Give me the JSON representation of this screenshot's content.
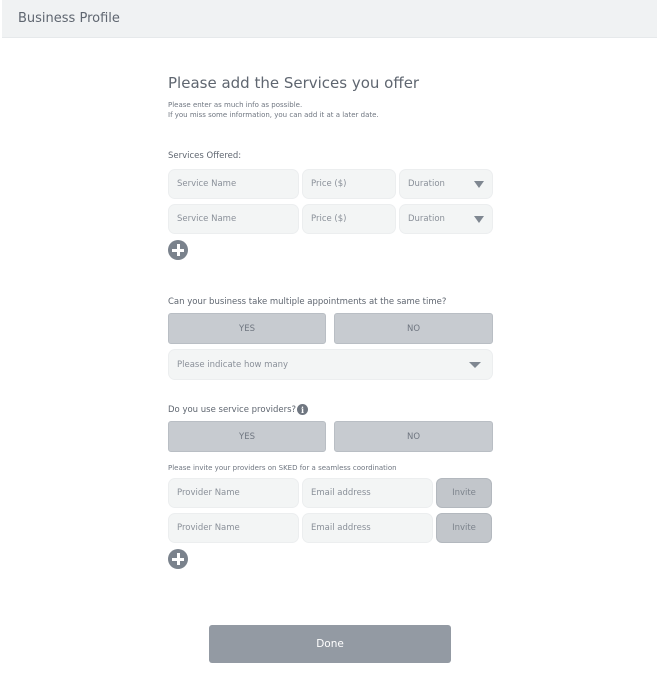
{
  "header": {
    "title": "Business Profile"
  },
  "intro": {
    "heading": "Please add the Services you offer",
    "line1": "Please enter as much info as possible.",
    "line2": "If you miss some information, you can add it at a later date."
  },
  "services": {
    "label": "Services Offered:",
    "rows": [
      {
        "name_placeholder": "Service Name",
        "price_placeholder": "Price ($)",
        "duration_placeholder": "Duration"
      },
      {
        "name_placeholder": "Service Name",
        "price_placeholder": "Price ($)",
        "duration_placeholder": "Duration"
      }
    ]
  },
  "multiple": {
    "question": "Can your business take multiple appointments at the same time?",
    "yes_label": "YES",
    "no_label": "NO",
    "select_placeholder": "Please indicate how many"
  },
  "providers": {
    "question": "Do you use service providers?",
    "yes_label": "YES",
    "no_label": "NO",
    "note": "Please invite your providers on SKED for a seamless coordination",
    "rows": [
      {
        "name_placeholder": "Provider Name",
        "email_placeholder": "Email address",
        "invite_label": "Invite"
      },
      {
        "name_placeholder": "Provider Name",
        "email_placeholder": "Email address",
        "invite_label": "Invite"
      }
    ]
  },
  "icons": {
    "add": "plus-circle-icon",
    "info": "info-circle-icon",
    "dropdown": "caret-down-icon"
  },
  "colors": {
    "button_gray": "#c7cbd0",
    "done_button": "#939aa3",
    "field_bg": "#f3f5f5",
    "header_bg": "#f0f2f3"
  },
  "done_label": "Done"
}
